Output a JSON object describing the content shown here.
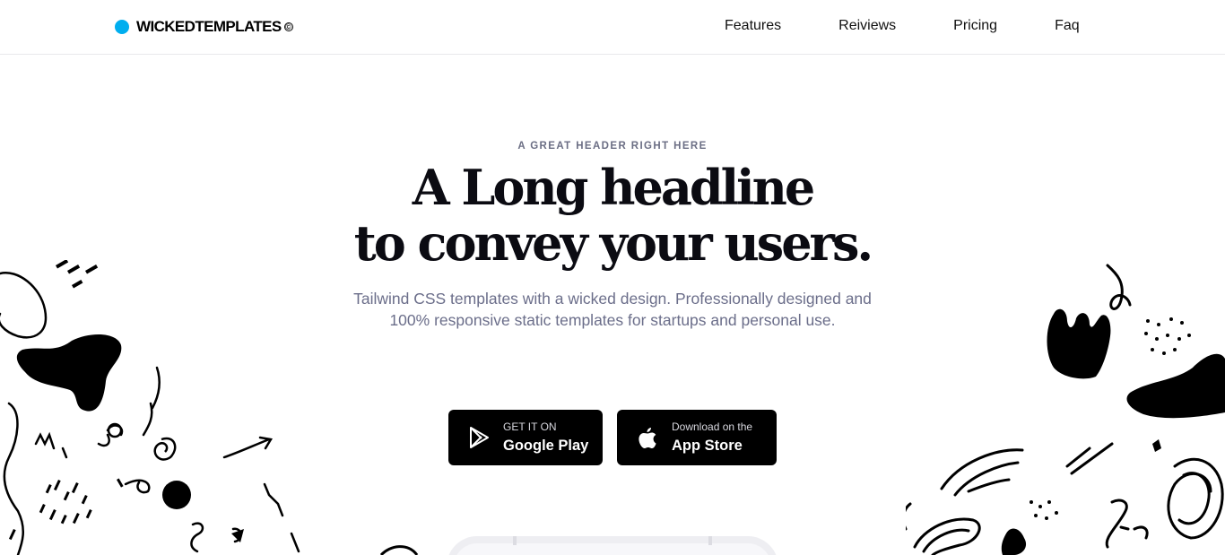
{
  "brand": {
    "name": "WICKEDTEMPLATES",
    "mark": "©",
    "dot_color": "#00aeef"
  },
  "nav": {
    "items": [
      "Features",
      "Reiviews",
      "Pricing",
      "Faq"
    ]
  },
  "hero": {
    "eyebrow": "A GREAT HEADER RIGHT HERE",
    "headline_line1": "A Long headline",
    "headline_line2": "to convey your users.",
    "subtitle_line1": "Tailwind CSS templates with a wicked design. Professionally designed and",
    "subtitle_line2": "100% responsive static templates for startups and personal use."
  },
  "buttons": {
    "google": {
      "small": "GET IT ON",
      "large": "Google Play",
      "icon": "play-store-icon"
    },
    "apple": {
      "small": "Download on the",
      "large": "App Store",
      "icon": "apple-icon"
    }
  },
  "colors": {
    "accent": "#00aeef",
    "text_muted": "#6b6e8a",
    "button_bg": "#000000"
  }
}
